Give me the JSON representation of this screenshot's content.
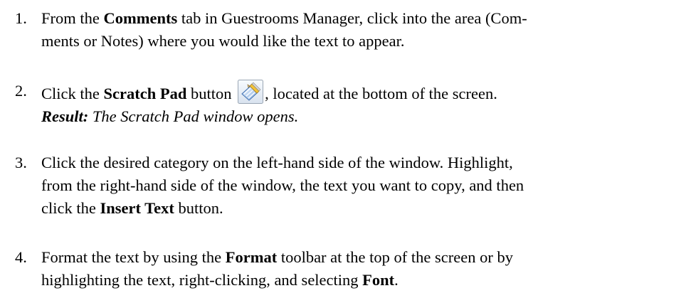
{
  "steps": [
    {
      "number": "1.",
      "line1_pre": "From the ",
      "line1_bold": "Comments",
      "line1_post": " tab in Guestrooms Manager, click into the area (Com-",
      "line2": "ments or Notes) where you would like the text to appear."
    },
    {
      "number": "2.",
      "line1_pre": "Click the ",
      "line1_bold": "Scratch Pad",
      "line1_mid": " button ",
      "icon": "scratch-pad-icon",
      "line1_post": ", located at the bottom of the screen.",
      "result_label": "Result:",
      "result_text": " The Scratch Pad window opens."
    },
    {
      "number": "3.",
      "line1": "Click the desired category on the left-hand side of the window. Highlight,",
      "line2": "from the right-hand side of the window, the text you want to copy, and then",
      "line3_pre": "click the ",
      "line3_bold": "Insert Text",
      "line3_post": " button."
    },
    {
      "number": "4.",
      "line1_pre": "Format the text by using the ",
      "line1_bold": "Format",
      "line1_post": " toolbar at the top of the screen or by",
      "line2_pre": "highlighting the text, right-clicking, and selecting ",
      "line2_bold": "Font",
      "line2_post": "."
    }
  ],
  "colors": {
    "text": "#000000",
    "icon_border": "#9aa6b4",
    "icon_fill": "#e8eef6"
  }
}
